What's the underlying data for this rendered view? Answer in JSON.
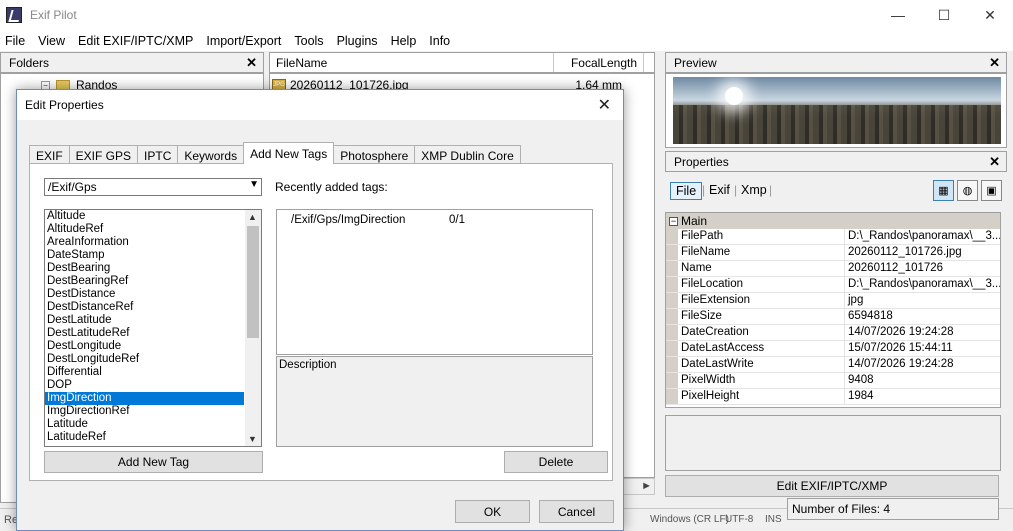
{
  "window": {
    "title": "Exif Pilot",
    "minimize": "—",
    "maximize": "☐",
    "close": "✕"
  },
  "menu": [
    "File",
    "View",
    "Edit EXIF/IPTC/XMP",
    "Import/Export",
    "Tools",
    "Plugins",
    "Help",
    "Info"
  ],
  "folders": {
    "title": "Folders",
    "close": "✕",
    "item": "Randos",
    "expander": "−"
  },
  "filelist": {
    "col_filename": "FileName",
    "col_focal": "FocalLength",
    "file_name": "20260112_101726.jpg",
    "file_focal": "1.64 mm",
    "file_icon_text": "JPG"
  },
  "preview": {
    "title": "Preview",
    "close": "✕"
  },
  "properties": {
    "title": "Properties",
    "close": "✕",
    "tabs": [
      "File",
      "Exif",
      "Xmp"
    ],
    "category": "Main",
    "category_toggle": "−",
    "rows": [
      {
        "key": "FilePath",
        "value": "D:\\_Randos\\panoramax\\__3..."
      },
      {
        "key": "FileName",
        "value": "20260112_101726.jpg"
      },
      {
        "key": "Name",
        "value": "20260112_101726"
      },
      {
        "key": "FileLocation",
        "value": "D:\\_Randos\\panoramax\\__3..."
      },
      {
        "key": "FileExtension",
        "value": "jpg"
      },
      {
        "key": "FileSize",
        "value": "6594818"
      },
      {
        "key": "DateCreation",
        "value": "14/07/2026 19:24:28"
      },
      {
        "key": "DateLastAccess",
        "value": "15/07/2026 15:44:11"
      },
      {
        "key": "DateLastWrite",
        "value": "14/07/2026 19:24:28"
      },
      {
        "key": "PixelWidth",
        "value": "9408"
      },
      {
        "key": "PixelHeight",
        "value": "1984"
      }
    ],
    "edit_button": "Edit EXIF/IPTC/XMP"
  },
  "status": {
    "left": "Re",
    "encoding": "Windows (CR LF)",
    "charset": "UTF-8",
    "mode": "INS",
    "number_of_files": "Number of Files: 4"
  },
  "dialog": {
    "title": "Edit Properties",
    "close": "✕",
    "tabs": [
      "EXIF",
      "EXIF GPS",
      "IPTC",
      "Keywords",
      "Add New Tags",
      "Photosphere",
      "XMP Dublin Core"
    ],
    "active_tab": "Add New Tags",
    "path_value": "/Exif/Gps",
    "tag_list": [
      "Altitude",
      "AltitudeRef",
      "AreaInformation",
      "DateStamp",
      "DestBearing",
      "DestBearingRef",
      "DestDistance",
      "DestDistanceRef",
      "DestLatitude",
      "DestLatitudeRef",
      "DestLongitude",
      "DestLongitudeRef",
      "Differential",
      "DOP",
      "ImgDirection",
      "ImgDirectionRef",
      "Latitude",
      "LatitudeRef"
    ],
    "selected_tag": "ImgDirection",
    "recent_label": "Recently added tags:",
    "recent_tag": "/Exif/Gps/ImgDirection",
    "recent_value": "0/1",
    "description_label": "Description",
    "add_button": "Add New Tag",
    "delete_button": "Delete",
    "ok_button": "OK",
    "cancel_button": "Cancel"
  }
}
